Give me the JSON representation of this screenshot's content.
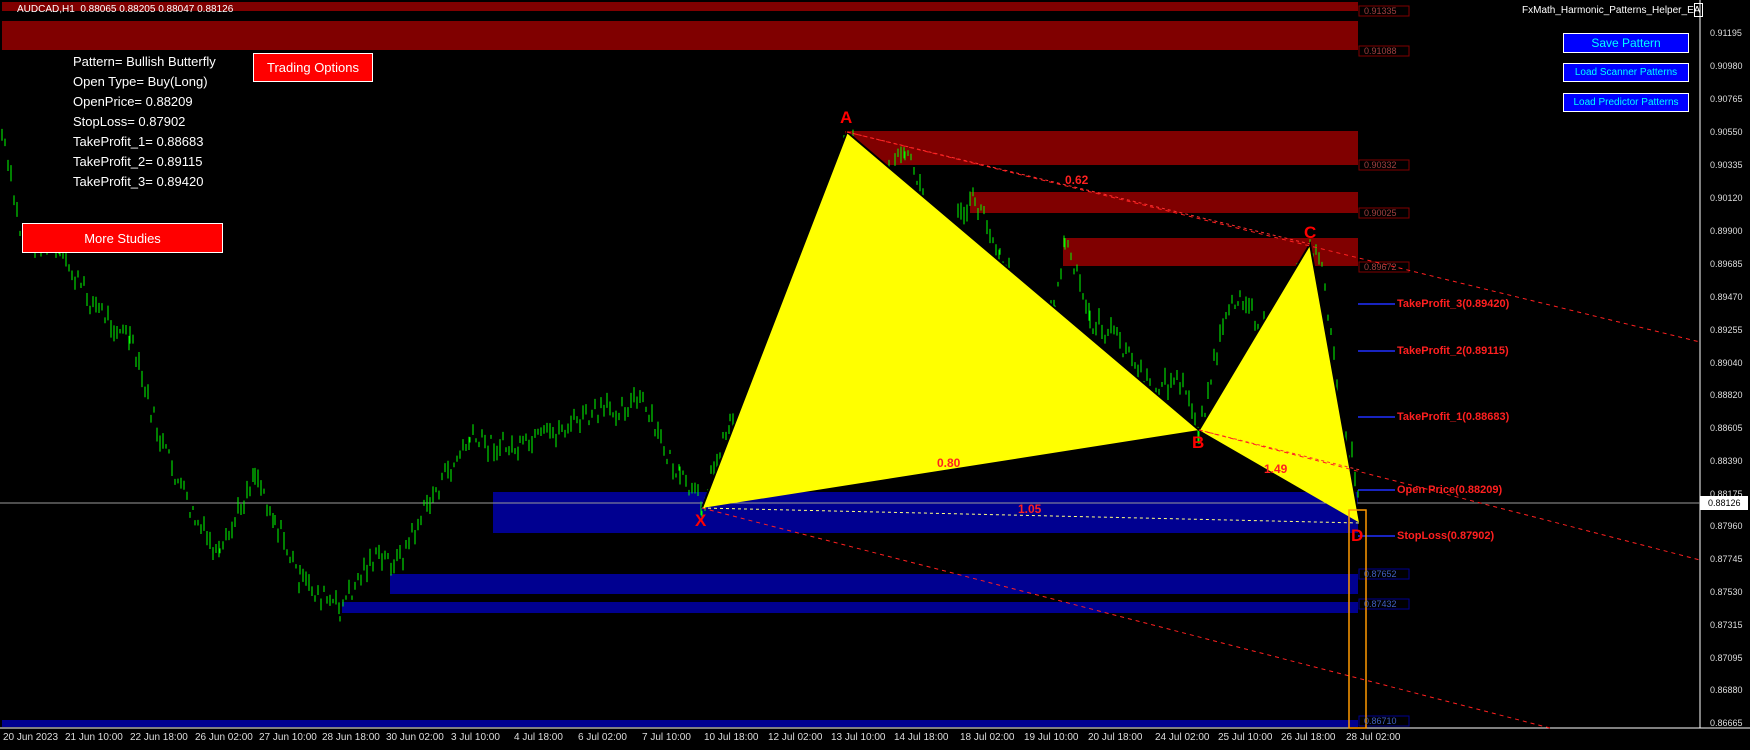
{
  "header": {
    "symbol_info": "AUDCAD,H1  0.88065 0.88205 0.88047 0.88126",
    "ea_name": "FxMath_Harmonic_Patterns_Helper_EA"
  },
  "pattern_info": {
    "pattern": "Pattern= Bullish Butterfly",
    "open_type": "Open Type= Buy(Long)",
    "open_price": "OpenPrice= 0.88209",
    "stop_loss": "StopLoss= 0.87902",
    "tp1": "TakeProfit_1= 0.88683",
    "tp2": "TakeProfit_2= 0.89115",
    "tp3": "TakeProfit_3= 0.89420"
  },
  "buttons": {
    "trading_options": "Trading Options",
    "more_studies": "More Studies",
    "save_pattern": "Save Pattern",
    "load_scanner": "Load Scanner Patterns",
    "load_predictor": "Load Predictor Patterns"
  },
  "points": {
    "x": "X",
    "a": "A",
    "b": "B",
    "c": "C",
    "d": "D"
  },
  "ratios": {
    "ab": "0.62",
    "xb": "0.80",
    "bc_cd": "1.49",
    "xd": "1.05"
  },
  "levels": {
    "tp3": "TakeProfit_3(0.89420)",
    "tp2": "TakeProfit_2(0.89115)",
    "tp1": "TakeProfit_1(0.88683)",
    "open": "Open Price(0.88209)",
    "sl": "StopLoss(0.87902)"
  },
  "zone_prices": [
    "0.91335",
    "0.91088",
    "0.90332",
    "0.90025",
    "0.89672",
    "0.87652",
    "0.87432",
    "0.86710"
  ],
  "y_axis": [
    "0.91195",
    "0.90980",
    "0.90765",
    "0.90550",
    "0.90335",
    "0.90120",
    "0.89900",
    "0.89685",
    "0.89470",
    "0.89255",
    "0.89040",
    "0.88820",
    "0.88605",
    "0.88390",
    "0.88175",
    "0.87960",
    "0.87745",
    "0.87530",
    "0.87315",
    "0.87095",
    "0.86880",
    "0.86665"
  ],
  "current_price": "0.88126",
  "x_axis": [
    "20 Jun 2023",
    "21 Jun 10:00",
    "22 Jun 18:00",
    "26 Jun 02:00",
    "27 Jun 10:00",
    "28 Jun 18:00",
    "30 Jun 02:00",
    "3 Jul 10:00",
    "4 Jul 18:00",
    "6 Jul 02:00",
    "7 Jul 10:00",
    "10 Jul 18:00",
    "12 Jul 02:00",
    "13 Jul 10:00",
    "14 Jul 18:00",
    "18 Jul 02:00",
    "19 Jul 10:00",
    "20 Jul 18:00",
    "24 Jul 02:00",
    "25 Jul 10:00",
    "26 Jul 18:00",
    "28 Jul 02:00"
  ],
  "colors": {
    "background": "#000000",
    "candles": "#00ff00",
    "pattern_fill": "#ffff00",
    "supply_zone": "#800000",
    "demand_zone": "#000090",
    "pattern_label": "#ff0000",
    "button_red": "#ff0000",
    "button_blue": "#0000ff"
  }
}
